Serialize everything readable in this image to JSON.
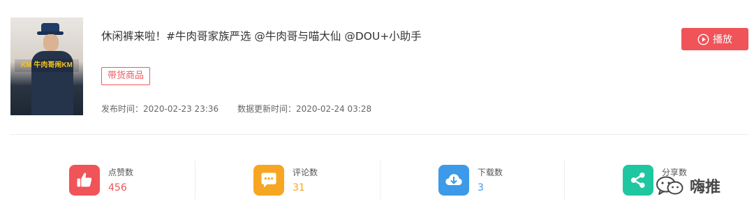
{
  "video": {
    "thumbnail_caption": "KM 牛肉哥闹KM",
    "title": "休闲裤来啦！#牛肉哥家族严选 @牛肉哥与喵大仙 @DOU+小助手",
    "tag": "带货商品",
    "published": "发布时间：2020-02-23 23:36",
    "updated": "数据更新时间：2020-02-24 03:28",
    "play_label": "播放"
  },
  "stats": [
    {
      "label": "点赞数",
      "value": "456",
      "color": "#f05358",
      "icon": "thumbs-up-icon"
    },
    {
      "label": "评论数",
      "value": "31",
      "color": "#f6a623",
      "icon": "comment-icon"
    },
    {
      "label": "下载数",
      "value": "3",
      "color": "#3d9ae8",
      "icon": "download-cloud-icon"
    },
    {
      "label": "分享数",
      "value": "",
      "color": "#1fc7a0",
      "icon": "share-icon"
    }
  ],
  "watermark": {
    "text": "嗨推",
    "icon": "wechat-icon"
  }
}
